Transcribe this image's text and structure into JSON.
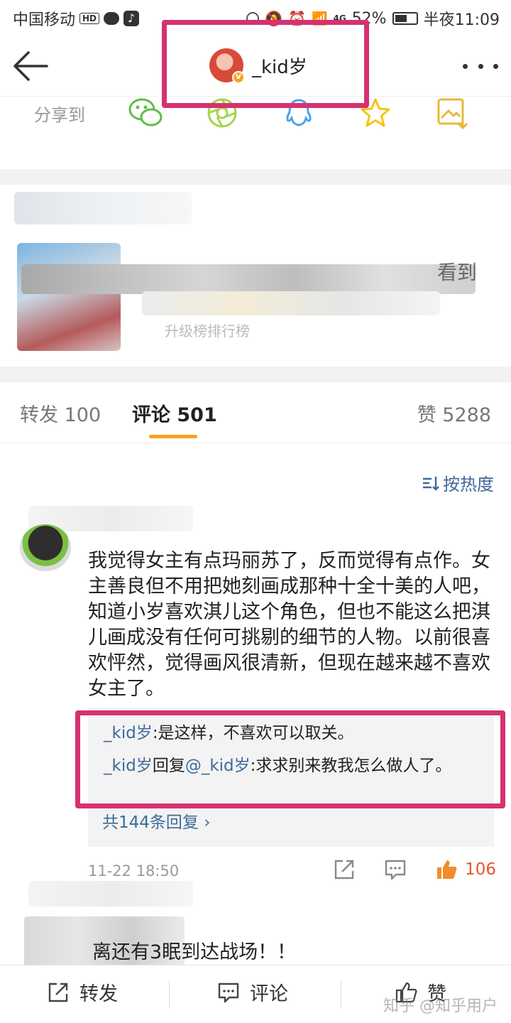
{
  "status_bar": {
    "carrier": "中国移动",
    "hd": "HD",
    "network": "4G",
    "battery": "52%",
    "time": "半夜11:09"
  },
  "nav": {
    "username": "_kid岁",
    "verified_badge": "V"
  },
  "share": {
    "label": "分享到",
    "icons": [
      "wechat-icon",
      "moments-icon",
      "qq-icon",
      "favorite-star-icon",
      "save-image-icon"
    ]
  },
  "repost_preview": {
    "fragment_right": "看到",
    "fragment_bottom": "升级榜排行榜"
  },
  "tabs": {
    "repost": "转发 100",
    "comment": "评论 501",
    "like": "赞 5288"
  },
  "sort": {
    "label": "按热度"
  },
  "comment": {
    "text": "我觉得女主有点玛丽苏了，反而觉得有点作。女主善良但不用把她刻画成那种十全十美的人吧，知道小岁喜欢淇儿这个角色，但也不能这么把淇儿画成没有任何可挑剔的细节的人物。以前很喜欢怦然，觉得画风很清新，但现在越来越不喜欢女主了。",
    "replies": [
      {
        "user": "_kid岁",
        "connector": "",
        "mention": "",
        "text": ":是这样，不喜欢可以取关。"
      },
      {
        "user": "_kid岁",
        "connector": "回复",
        "mention": "@_kid岁",
        "text": ":求求别来教我怎么做人了。"
      }
    ],
    "reply_count": "共144条回复 ›",
    "time": "11-22 18:50",
    "likes": "106"
  },
  "next_comment": {
    "text": "离还有3眠到达战场！！"
  },
  "bottom_bar": {
    "repost": "转发",
    "comment": "评论",
    "like": "赞"
  },
  "watermark": "知乎 @知乎用户",
  "colors": {
    "highlight": "#d63170",
    "link": "#3d6a99",
    "like": "#e8542c",
    "tab_underline": "#f7a21b"
  }
}
